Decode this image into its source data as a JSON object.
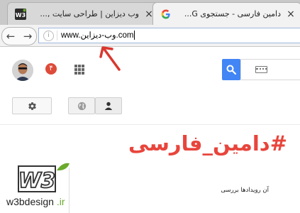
{
  "tabs": [
    {
      "title": "وب دیزاین | طراحی سایت ,...",
      "close": "×"
    },
    {
      "title": "دامین فارسی - جستجوی G...",
      "close": "×"
    }
  ],
  "urlbar": {
    "value": "www.وب-دیزاین.com"
  },
  "notifications": {
    "count": "۴"
  },
  "content": {
    "big_title": "#دامین_فارسی",
    "news_text": "آن رویدادها بررسی"
  },
  "watermark": {
    "brand": "w3bdesign",
    "tld": ".ir"
  },
  "colors": {
    "accent": "#e8453c",
    "search_blue": "#4285f4",
    "notif_red": "#dd4b39",
    "arrow_red": "#d9382f"
  }
}
